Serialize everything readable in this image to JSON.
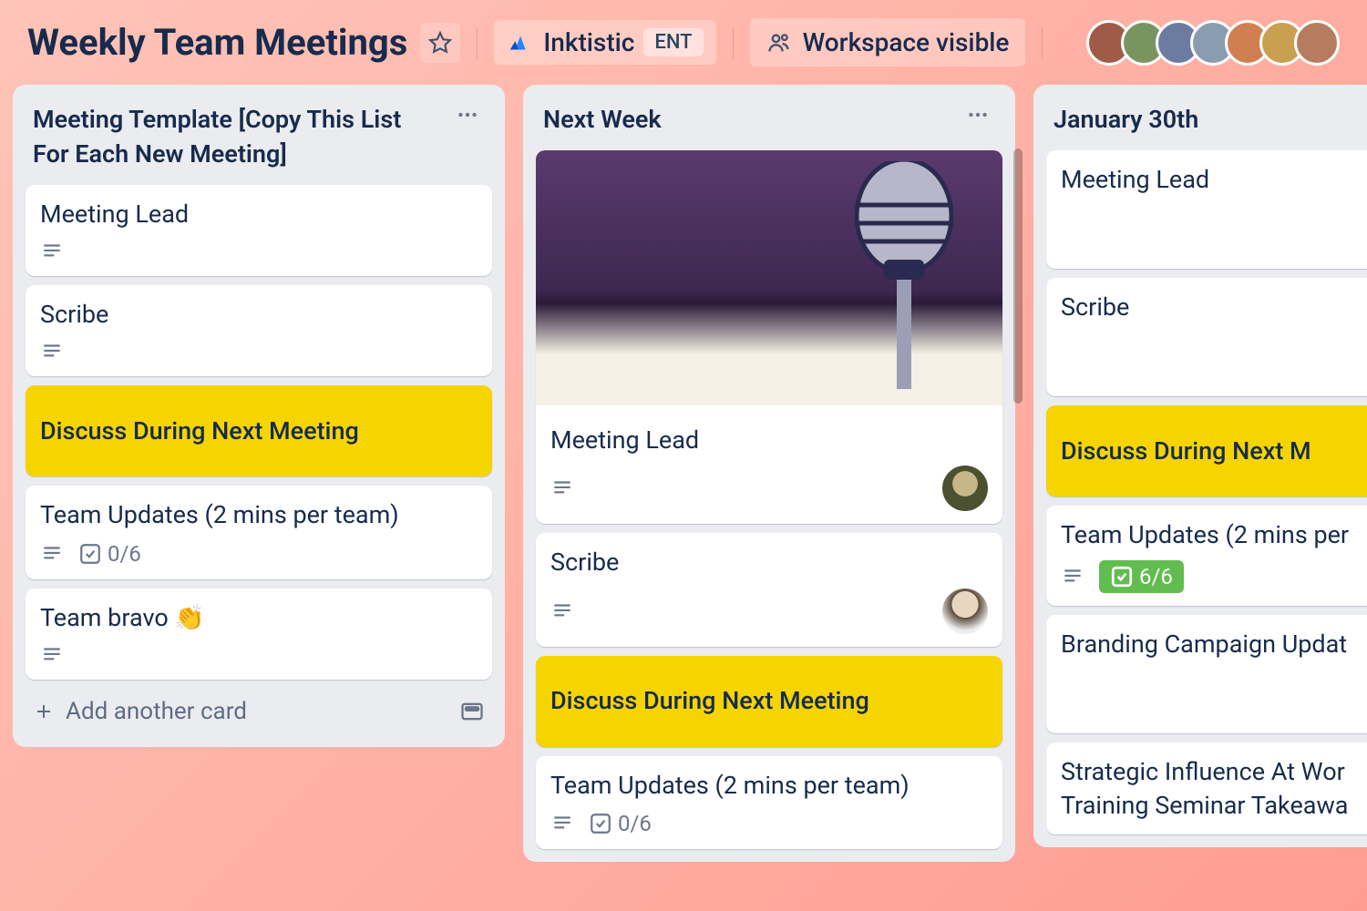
{
  "header": {
    "board_title": "Weekly Team Meetings",
    "workspace_name": "Inktistic",
    "workspace_badge": "ENT",
    "visibility_label": "Workspace visible"
  },
  "avatars": {
    "count": 7,
    "colors": [
      "#a05a48",
      "#7a9460",
      "#6c7ba0",
      "#8a9cb0",
      "#d08050",
      "#c9a050",
      "#b57c60"
    ]
  },
  "lists": [
    {
      "title": "Meeting Template [Copy This List For Each New Meeting]",
      "cards": [
        {
          "title": "Meeting Lead",
          "has_description": true
        },
        {
          "title": "Scribe",
          "has_description": true
        },
        {
          "title": "Discuss During Next Meeting",
          "style": "yellow"
        },
        {
          "title": "Team Updates (2 mins per team)",
          "has_description": true,
          "checklist": "0/6"
        },
        {
          "title": "Team bravo 👏",
          "has_description": true
        }
      ],
      "add_card_label": "Add another card"
    },
    {
      "title": "Next Week",
      "cards": [
        {
          "title": "Meeting Lead",
          "has_description": true,
          "has_cover": true,
          "has_avatar": true
        },
        {
          "title": "Scribe",
          "has_description": true,
          "has_avatar": true
        },
        {
          "title": "Discuss During Next Meeting",
          "style": "yellow"
        },
        {
          "title": "Team Updates (2 mins per team)",
          "has_description": true,
          "checklist": "0/6"
        }
      ]
    },
    {
      "title": "January 30th",
      "cards": [
        {
          "title": "Meeting Lead"
        },
        {
          "title": "Scribe"
        },
        {
          "title": "Discuss During Next M",
          "style": "yellow"
        },
        {
          "title": "Team Updates (2 mins per",
          "has_description": true,
          "checklist": "6/6",
          "checklist_done": true
        },
        {
          "title": "Branding Campaign Updat"
        },
        {
          "title": "Strategic Influence At Wor Training Seminar Takeawa"
        }
      ]
    }
  ]
}
